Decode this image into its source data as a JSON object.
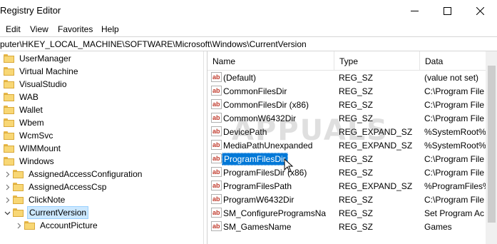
{
  "window": {
    "title": "Registry Editor"
  },
  "menu": [
    "Edit",
    "View",
    "Favorites",
    "Help"
  ],
  "address": "puter\\HKEY_LOCAL_MACHINE\\SOFTWARE\\Microsoft\\Windows\\CurrentVersion",
  "tree": [
    {
      "label": "UserManager",
      "indent": 0,
      "expander": ""
    },
    {
      "label": "Virtual Machine",
      "indent": 0,
      "expander": ""
    },
    {
      "label": "VisualStudio",
      "indent": 0,
      "expander": ""
    },
    {
      "label": "WAB",
      "indent": 0,
      "expander": ""
    },
    {
      "label": "Wallet",
      "indent": 0,
      "expander": ""
    },
    {
      "label": "Wbem",
      "indent": 0,
      "expander": ""
    },
    {
      "label": "WcmSvc",
      "indent": 0,
      "expander": ""
    },
    {
      "label": "WIMMount",
      "indent": 0,
      "expander": ""
    },
    {
      "label": "Windows",
      "indent": 0,
      "expander": ""
    },
    {
      "label": "AssignedAccessConfiguration",
      "indent": 1,
      "expander": "collapsed"
    },
    {
      "label": "AssignedAccessCsp",
      "indent": 1,
      "expander": "collapsed"
    },
    {
      "label": "ClickNote",
      "indent": 1,
      "expander": "collapsed"
    },
    {
      "label": "CurrentVersion",
      "indent": 1,
      "expander": "expanded",
      "selected": true
    },
    {
      "label": "AccountPicture",
      "indent": 2,
      "expander": "collapsed"
    }
  ],
  "columns": {
    "name": "Name",
    "type": "Type",
    "data": "Data"
  },
  "values": [
    {
      "name": "(Default)",
      "type": "REG_SZ",
      "data": "(value not set)"
    },
    {
      "name": "CommonFilesDir",
      "type": "REG_SZ",
      "data": "C:\\Program File"
    },
    {
      "name": "CommonFilesDir (x86)",
      "type": "REG_SZ",
      "data": "C:\\Program File"
    },
    {
      "name": "CommonW6432Dir",
      "type": "REG_SZ",
      "data": "C:\\Program File"
    },
    {
      "name": "DevicePath",
      "type": "REG_EXPAND_SZ",
      "data": "%SystemRoot%"
    },
    {
      "name": "MediaPathUnexpanded",
      "type": "REG_EXPAND_SZ",
      "data": "%SystemRoot%"
    },
    {
      "name": "ProgramFilesDir",
      "type": "REG_SZ",
      "data": "C:\\Program File",
      "selected": true
    },
    {
      "name": "ProgramFilesDir (x86)",
      "type": "REG_SZ",
      "data": "C:\\Program File"
    },
    {
      "name": "ProgramFilesPath",
      "type": "REG_EXPAND_SZ",
      "data": "%ProgramFiles%"
    },
    {
      "name": "ProgramW6432Dir",
      "type": "REG_SZ",
      "data": "C:\\Program File"
    },
    {
      "name": "SM_ConfigureProgramsNa",
      "type": "REG_SZ",
      "data": "Set Program Ac"
    },
    {
      "name": "SM_GamesName",
      "type": "REG_SZ",
      "data": "Games"
    }
  ],
  "watermark": "APPUALS",
  "colors": {
    "selection": "#0078d7",
    "tree_selection": "#cce8ff",
    "folder": "#f8d775",
    "string_icon": "#c0392b"
  }
}
